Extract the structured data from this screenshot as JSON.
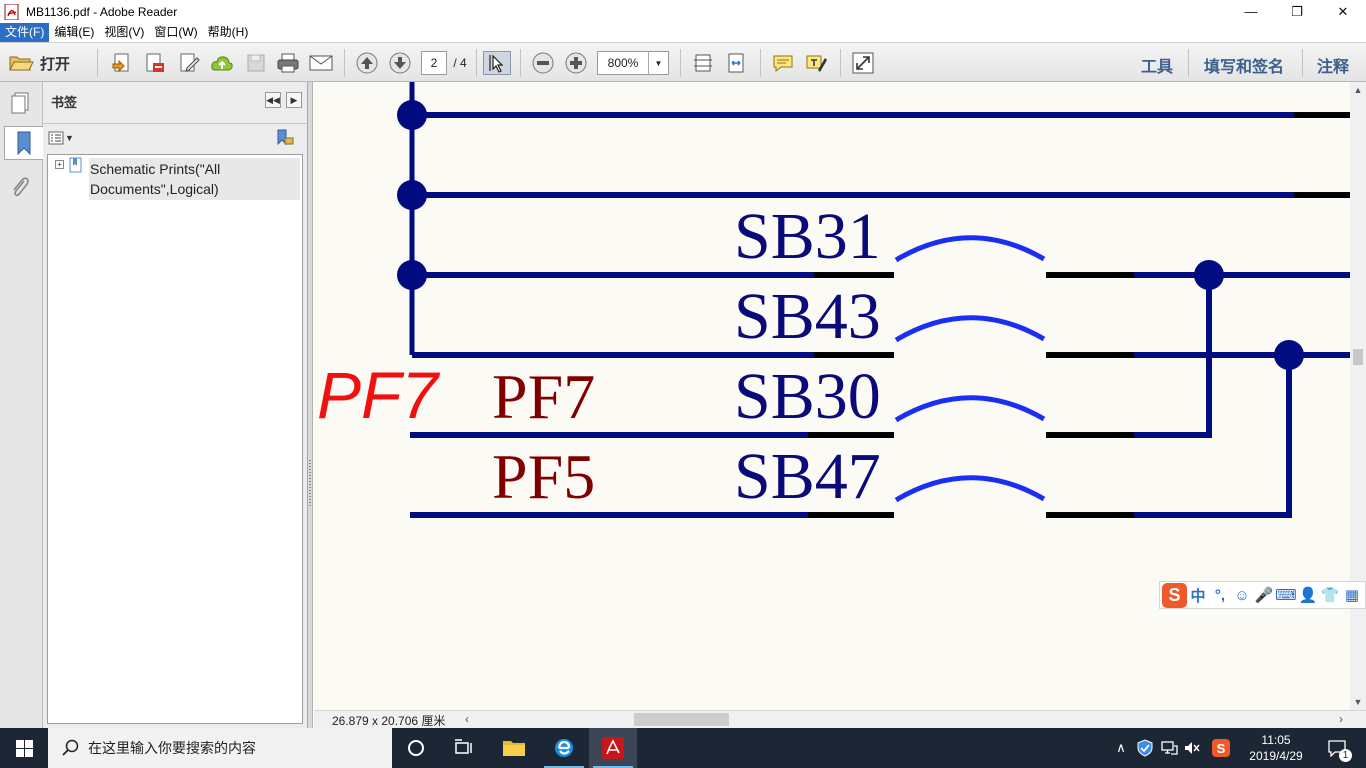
{
  "window": {
    "title": "MB1136.pdf - Adobe Reader",
    "minimize": "—",
    "restore": "❐",
    "close": "✕"
  },
  "menubar": {
    "items": [
      {
        "label": "文件(F)"
      },
      {
        "label": "编辑(E)"
      },
      {
        "label": "视图(V)"
      },
      {
        "label": "窗口(W)"
      },
      {
        "label": "帮助(H)"
      }
    ]
  },
  "toolbar": {
    "open_label": "打开",
    "page_current": "2",
    "page_total": "/ 4",
    "zoom_value": "800%",
    "tools_label": "工具",
    "fill_sign_label": "填写和签名",
    "comment_label": "注释"
  },
  "bookmarks": {
    "title": "书签",
    "items": [
      {
        "label": "Schematic Prints(\"All Documents\",Logical)"
      }
    ]
  },
  "schematic": {
    "labels": {
      "pf7_highlight": "PF7",
      "pf7": "PF7",
      "pf5": "PF5",
      "sb31": "SB31",
      "sb43": "SB43",
      "sb30": "SB30",
      "sb47": "SB47"
    },
    "colors": {
      "wire": "#000c80",
      "wire_end": "#000000",
      "arc": "#1b2ef2",
      "net_label": "#800000",
      "part_label": "#0a0a7a",
      "highlight": "#f01010"
    }
  },
  "statusbar": {
    "page_size": "26.879 x 20.706 厘米"
  },
  "ime": {
    "logo": "S",
    "items": [
      "中",
      "°,",
      "☺",
      "🎤",
      "⌨",
      "👤",
      "👕",
      "▦"
    ]
  },
  "taskbar": {
    "search_placeholder": "在这里输入你要搜索的内容",
    "tray_chevron": "∧",
    "clock_time": "11:05",
    "clock_date": "2019/4/29",
    "notification_count": "1"
  }
}
